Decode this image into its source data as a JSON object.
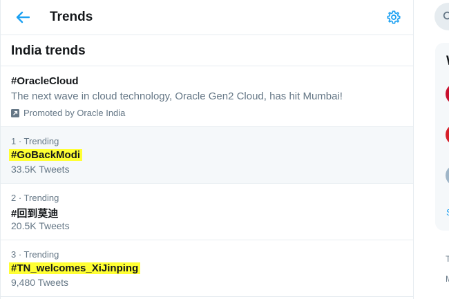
{
  "header": {
    "title": "Trends",
    "back_icon": "arrow-left-icon",
    "settings_icon": "gear-icon"
  },
  "section": {
    "title": "India trends"
  },
  "promoted": {
    "tag": "#OracleCloud",
    "description": "The next wave in cloud technology, Oracle Gen2 Cloud, has hit Mumbai!",
    "promoted_by": "Promoted by Oracle India"
  },
  "trends": [
    {
      "meta": "1 · Trending",
      "tag": "#GoBackModi",
      "count": "33.5K Tweets",
      "highlighted": true
    },
    {
      "meta": "2 · Trending",
      "tag": "#回到莫迪",
      "count": "20.5K Tweets",
      "highlighted": false
    },
    {
      "meta": "3 · Trending",
      "tag": "#TN_welcomes_XiJinping",
      "count": "9,480 Tweets",
      "highlighted": true
    }
  ],
  "sidebar": {
    "card_header": "W",
    "more_link": "S",
    "footer_1": "T",
    "footer_2": "M"
  },
  "colors": {
    "accent": "#1da1f2",
    "highlight": "#ffff33",
    "muted": "#657786",
    "border": "#e6ecf0"
  }
}
